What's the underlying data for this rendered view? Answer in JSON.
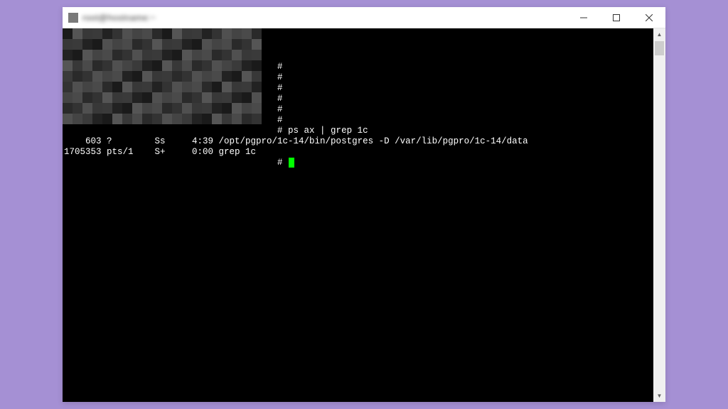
{
  "window": {
    "title": "root@hostname:~"
  },
  "terminal": {
    "prompt_char": "#",
    "blurred_prompt_lines": 6,
    "command": "ps ax | grep 1c",
    "output_lines": [
      "    603 ?        Ss     4:39 /opt/pgpro/1c-14/bin/postgres -D /var/lib/pgpro/1c-14/data",
      "1705353 pts/1    S+     0:00 grep 1c"
    ],
    "cursor_prompt": "# "
  },
  "colors": {
    "cursor": "#00ff00",
    "terminal_bg": "#000000",
    "terminal_fg": "#ffffff",
    "page_bg": "#a590d4"
  }
}
